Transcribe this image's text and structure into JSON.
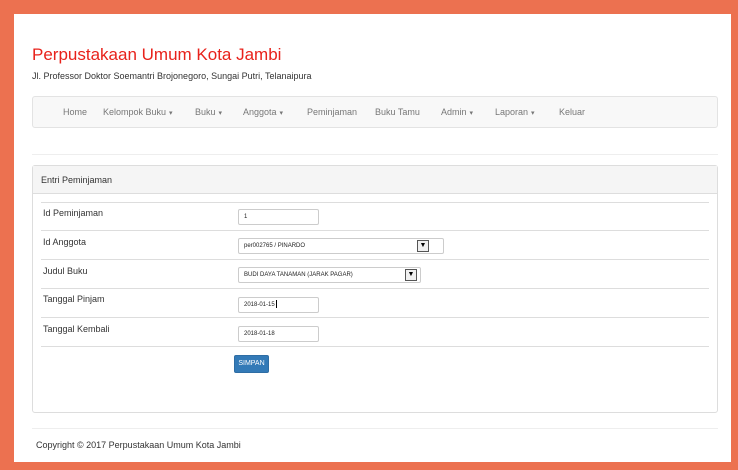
{
  "site": {
    "title": "Perpustakaan Umum Kota Jambi",
    "address": "Jl. Professor Doktor Soemantri Brojonegoro, Sungai Putri, Telanaipura"
  },
  "nav": {
    "items": [
      {
        "label": "Home",
        "dropdown": false
      },
      {
        "label": "Kelompok Buku",
        "dropdown": true
      },
      {
        "label": "Buku",
        "dropdown": true
      },
      {
        "label": "Anggota",
        "dropdown": true
      },
      {
        "label": "Peminjaman",
        "dropdown": false
      },
      {
        "label": "Buku Tamu",
        "dropdown": false
      },
      {
        "label": "Admin",
        "dropdown": true
      },
      {
        "label": "Laporan",
        "dropdown": true
      },
      {
        "label": "Keluar",
        "dropdown": false
      }
    ],
    "caret": "▾"
  },
  "panel": {
    "title": "Entri Peminjaman",
    "fields": [
      {
        "label": "Id Peminjaman",
        "value": "1"
      },
      {
        "label": "Id Anggota",
        "value": "per002765 / PINARDO"
      },
      {
        "label": "Judul Buku",
        "value": "BUDI DAYA TANAMAN (JARAK PAGAR)"
      },
      {
        "label": "Tanggal Pinjam",
        "value": "2018-01-15"
      },
      {
        "label": "Tanggal Kembali",
        "value": "2018-01-18"
      }
    ],
    "submit_label": "SIMPAN"
  },
  "footer": {
    "copyright": "Copyright © 2017 Perpustakaan Umum Kota Jambi"
  }
}
